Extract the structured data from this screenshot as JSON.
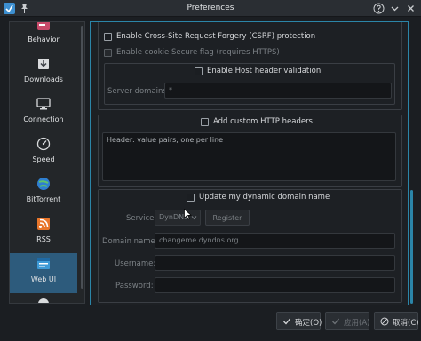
{
  "window": {
    "title": "Preferences"
  },
  "sidebar": {
    "items": [
      {
        "label": "Behavior",
        "icon": "behavior-icon"
      },
      {
        "label": "Downloads",
        "icon": "downloads-icon"
      },
      {
        "label": "Connection",
        "icon": "connection-icon"
      },
      {
        "label": "Speed",
        "icon": "speed-icon"
      },
      {
        "label": "BitTorrent",
        "icon": "bittorrent-icon"
      },
      {
        "label": "RSS",
        "icon": "rss-icon"
      },
      {
        "label": "Web UI",
        "icon": "webui-icon",
        "selected": true
      }
    ]
  },
  "webui": {
    "csrf_label": "Enable Cross-Site Request Forgery (CSRF) protection",
    "cookie_secure_label": "Enable cookie Secure flag (requires HTTPS)",
    "host_header_label": "Enable Host header validation",
    "server_domains_label": "Server domains:",
    "server_domains_value": "*",
    "custom_headers_label": "Add custom HTTP headers",
    "custom_headers_placeholder": "Header: value pairs, one per line",
    "dyndns_label": "Update my dynamic domain name",
    "service_label": "Service:",
    "service_value": "DynDNS",
    "register_label": "Register",
    "domain_name_label": "Domain name:",
    "domain_name_value": "changeme.dyndns.org",
    "username_label": "Username:",
    "password_label": "Password:"
  },
  "buttons": {
    "ok": "确定(O)",
    "apply": "应用(A)",
    "cancel": "取消(C)"
  },
  "colors": {
    "accent": "#2b85a8",
    "selected": "#2d5b7c"
  }
}
